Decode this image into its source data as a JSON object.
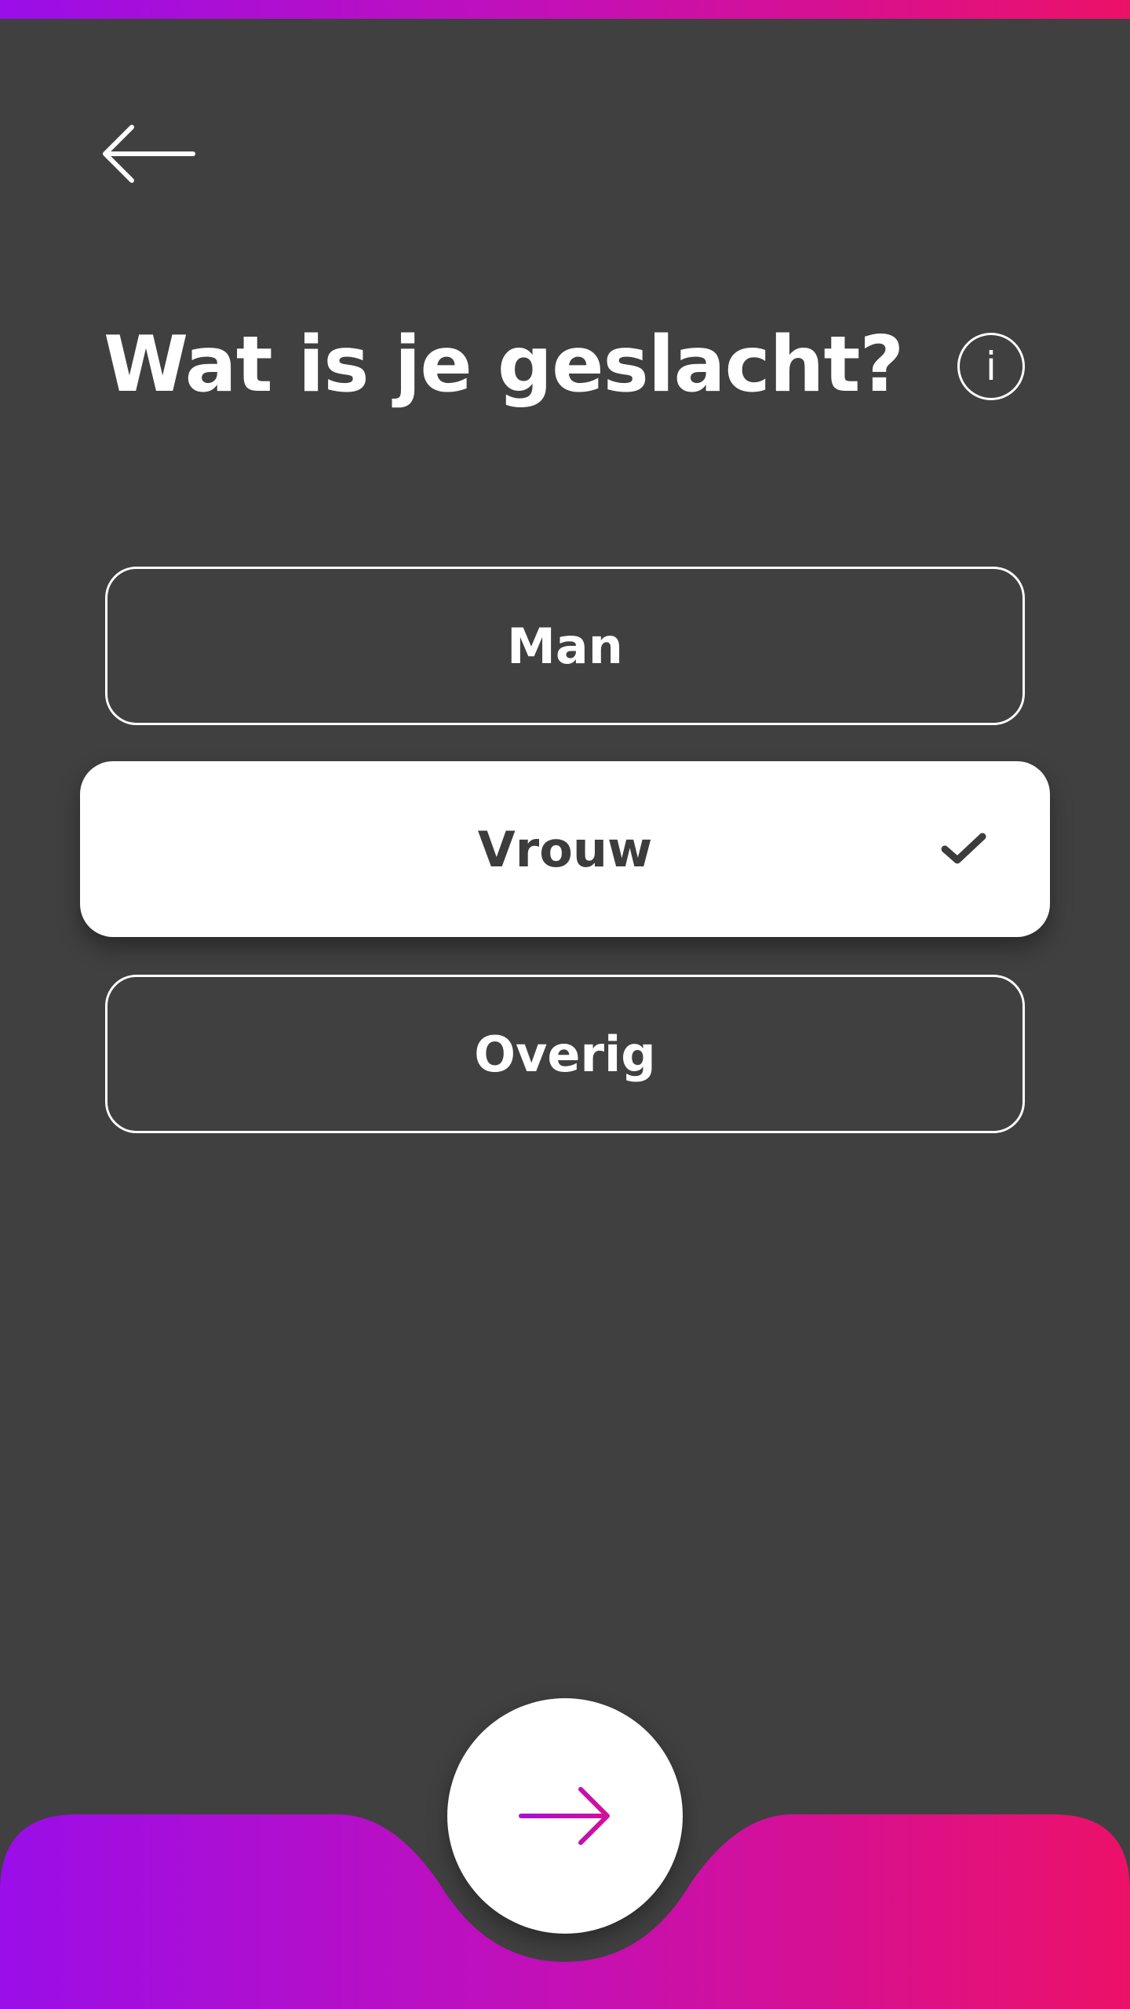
{
  "question": {
    "title": "Wat is je geslacht?"
  },
  "icons": {
    "back": "arrow-left-icon",
    "info": "info-icon",
    "info_glyph": "i",
    "check": "check-icon",
    "next": "arrow-right-icon"
  },
  "options": [
    {
      "label": "Man",
      "selected": false
    },
    {
      "label": "Vrouw",
      "selected": true
    },
    {
      "label": "Overig",
      "selected": false
    }
  ],
  "colors": {
    "background": "#404040",
    "gradient_start": "#9a0ee8",
    "gradient_end": "#ec1168",
    "selected_background": "#ffffff",
    "selected_text": "#3c3c3c"
  }
}
